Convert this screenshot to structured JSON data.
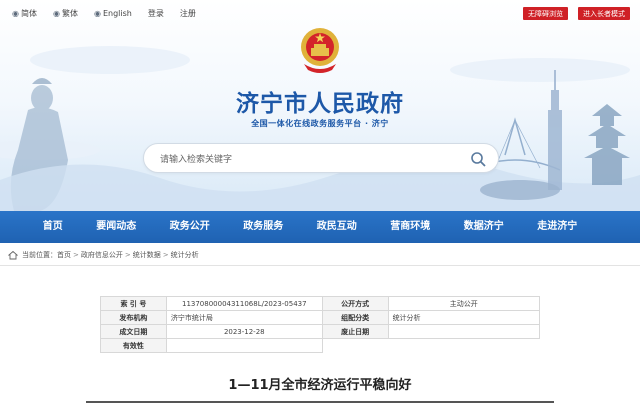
{
  "header": {
    "links": [
      {
        "icon": "language-icon",
        "label": "简体"
      },
      {
        "icon": "language-icon",
        "label": "繁体"
      },
      {
        "icon": "globe-icon",
        "label": "English"
      },
      {
        "icon": "user-icon",
        "label": "登录"
      },
      {
        "icon": "register-icon",
        "label": "注册"
      }
    ],
    "buttons": [
      "无障碍浏览",
      "进入长者模式"
    ]
  },
  "site": {
    "title": "济宁市人民政府",
    "subtitle": "全国一体化在线政务服务平台 · 济宁"
  },
  "search": {
    "placeholder": "请输入检索关键字"
  },
  "nav": {
    "items": [
      "首页",
      "要闻动态",
      "政务公开",
      "政务服务",
      "政民互动",
      "营商环境",
      "数据济宁",
      "走进济宁"
    ]
  },
  "breadcrumb": {
    "prefix": "当前位置：",
    "items": [
      "首页",
      "政府信息公开",
      "统计数据",
      "统计分析"
    ],
    "separator": ">"
  },
  "meta": {
    "rows": [
      {
        "l1": "索 引 号",
        "v1": "11370800004311068L/2023-05437",
        "l2": "公开方式",
        "v2": "主动公开"
      },
      {
        "l1": "发布机构",
        "v1": "济宁市统计局",
        "l2": "组配分类",
        "v2": "统计分析"
      },
      {
        "l1": "成文日期",
        "v1": "2023-12-28",
        "l2": "废止日期",
        "v2": ""
      },
      {
        "l1": "有效性",
        "v1": "",
        "l2": "",
        "v2": ""
      }
    ]
  },
  "article": {
    "title": "1—11月全市经济运行平稳向好"
  },
  "colors": {
    "brand_blue": "#1d58a8",
    "nav_blue": "#2a74c8",
    "button_red": "#cf2026"
  }
}
